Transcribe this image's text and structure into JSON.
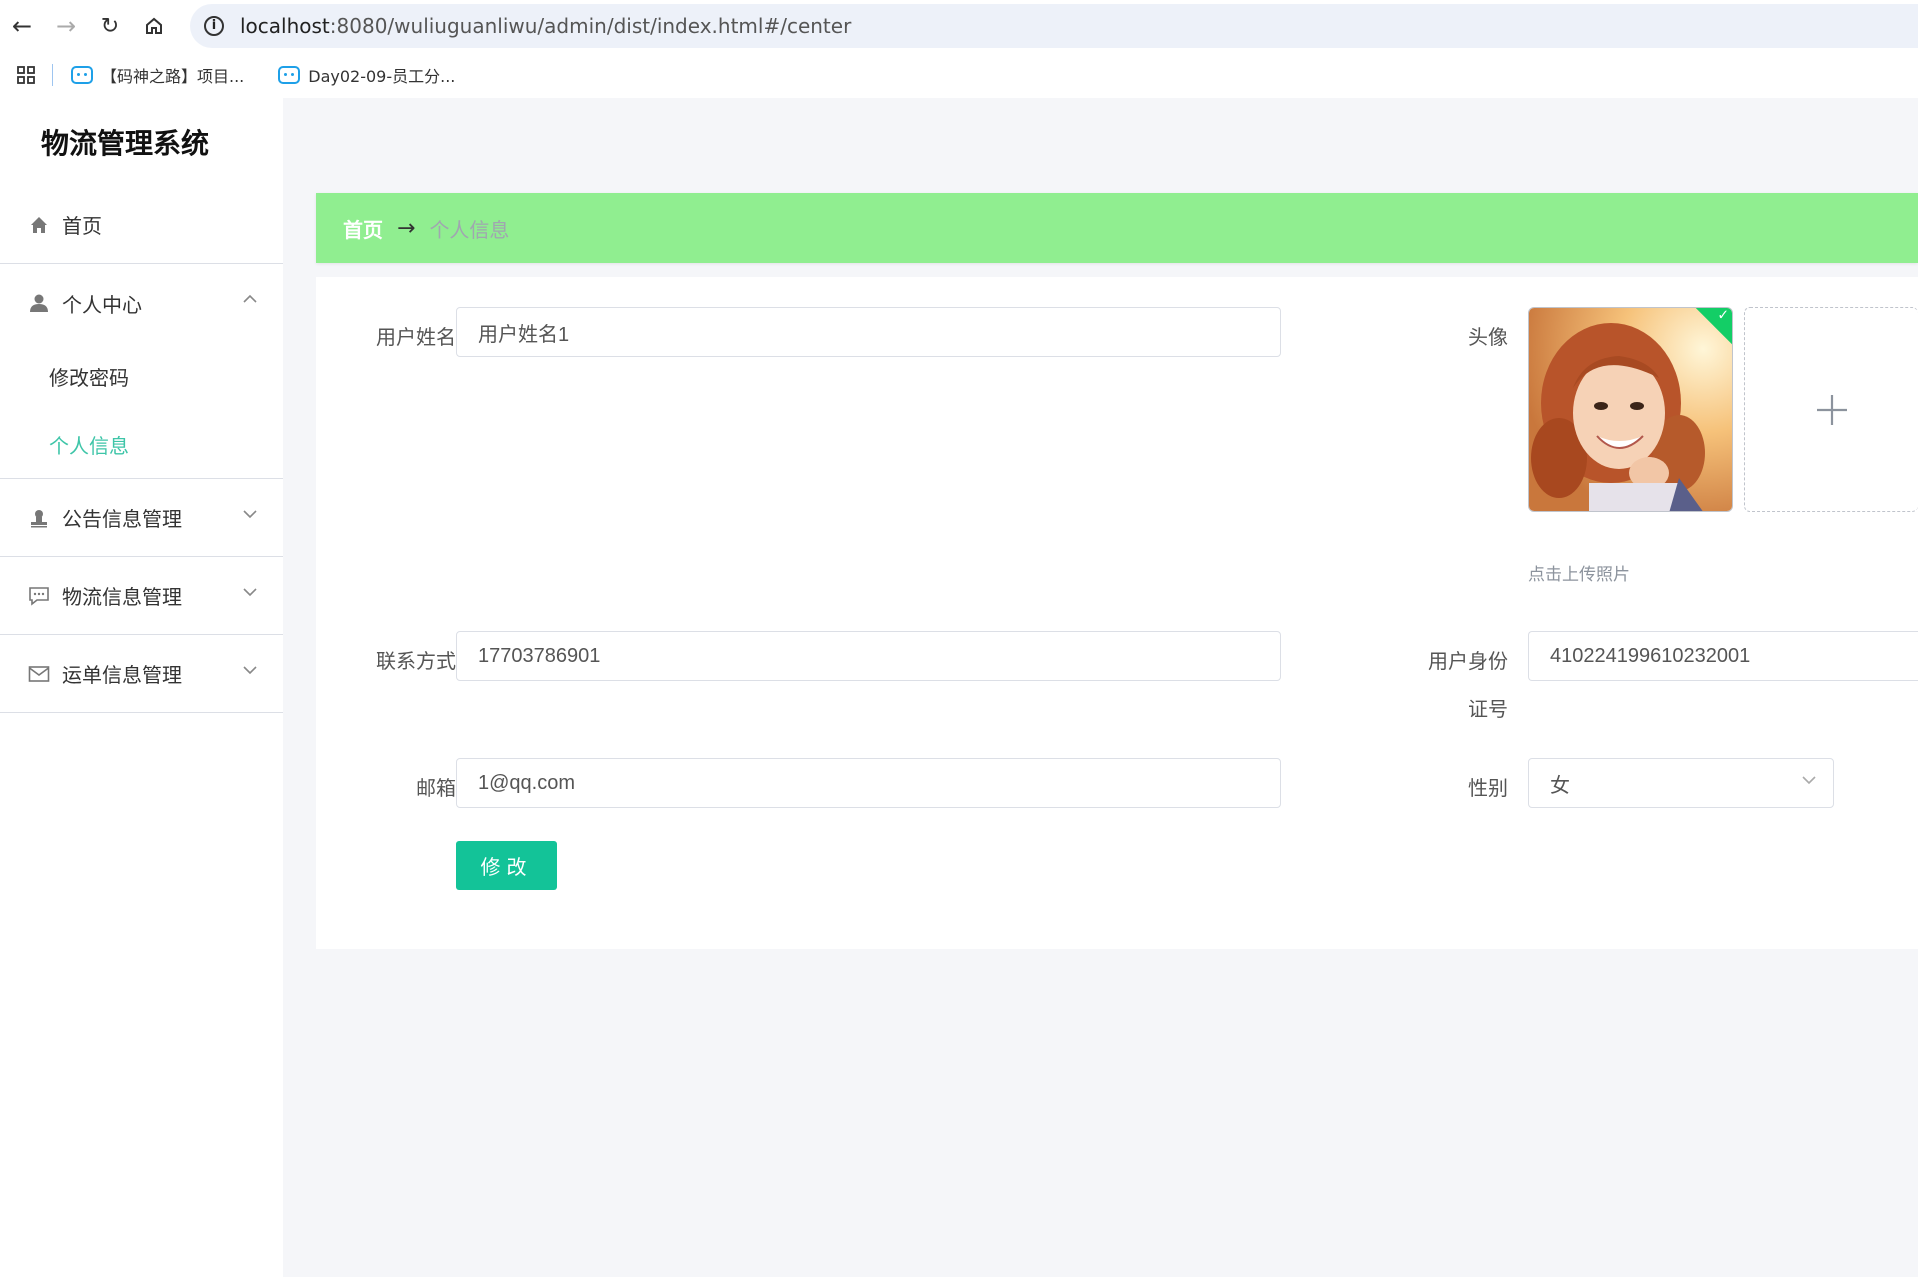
{
  "browser": {
    "url_host": "localhost",
    "url_path": ":8080/wuliuguanliwu/admin/dist/index.html#/center",
    "bookmarks": [
      "【码神之路】项目...",
      "Day02-09-员工分..."
    ]
  },
  "sidebar": {
    "title": "物流管理系统",
    "home": "首页",
    "personal_center": "个人中心",
    "submenu": [
      "修改密码",
      "个人信息"
    ],
    "announcement": "公告信息管理",
    "logistics": "物流信息管理",
    "waybill": "运单信息管理"
  },
  "breadcrumb": {
    "home": "首页",
    "arrow": "→",
    "current": "个人信息"
  },
  "form": {
    "username_label": "用户姓名",
    "username_value": "用户姓名1",
    "avatar_label": "头像",
    "upload_tip": "点击上传照片",
    "contact_label": "联系方式",
    "contact_value": "17703786901",
    "id_label_1": "用户身份",
    "id_label_2": "证号",
    "id_value": "410224199610232001",
    "email_label": "邮箱",
    "email_value": "1@qq.com",
    "gender_label": "性别",
    "gender_value": "女",
    "submit_label": "修改"
  },
  "colors": {
    "accent": "#13c398",
    "breadcrumb_bg": "#90ee90",
    "active_menu": "#3ec5a8"
  }
}
